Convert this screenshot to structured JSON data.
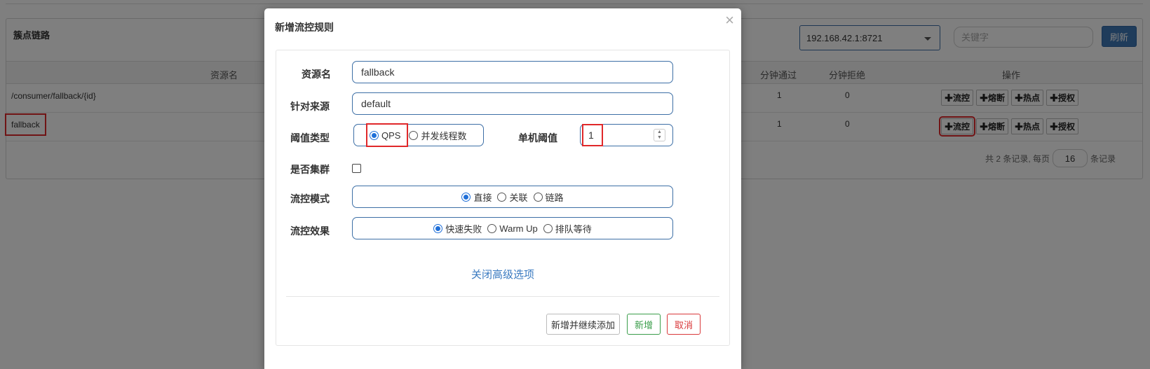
{
  "page": {
    "panel_title": "簇点链路",
    "machine_select": "192.168.42.1:8721",
    "search_placeholder": "关键字",
    "refresh_label": "刷新",
    "columns": {
      "resource": "资源名",
      "pass": "分钟通过",
      "block": "分钟拒绝",
      "ops": "操作"
    },
    "rows": [
      {
        "resource": "/consumer/fallback/{id}",
        "pass": "1",
        "block": "0"
      },
      {
        "resource": "fallback",
        "pass": "1",
        "block": "0"
      }
    ],
    "op_buttons": [
      "✚流控",
      "✚熔断",
      "✚热点",
      "✚授权"
    ],
    "pager": {
      "prefix": "共 2 条记录, 每页",
      "page_size": "16",
      "suffix": "条记录"
    }
  },
  "modal": {
    "title": "新增流控规则",
    "close": "×",
    "resource_label": "资源名",
    "resource_value": "fallback",
    "origin_label": "针对来源",
    "origin_value": "default",
    "threshold_type_label": "阈值类型",
    "threshold_type_options": [
      "QPS",
      "并发线程数"
    ],
    "threshold_label": "单机阈值",
    "threshold_value": "1",
    "cluster_label": "是否集群",
    "mode_label": "流控模式",
    "mode_options": [
      "直接",
      "关联",
      "链路"
    ],
    "effect_label": "流控效果",
    "effect_options": [
      "快速失败",
      "Warm Up",
      "排队等待"
    ],
    "advanced_link": "关闭高级选项",
    "buttons": {
      "add_continue": "新增并继续添加",
      "add": "新增",
      "cancel": "取消"
    },
    "colors": {
      "primary": "#3f78b7",
      "success": "#3a9d4a",
      "danger": "#d9383a",
      "highlight": "#e0282a"
    }
  }
}
